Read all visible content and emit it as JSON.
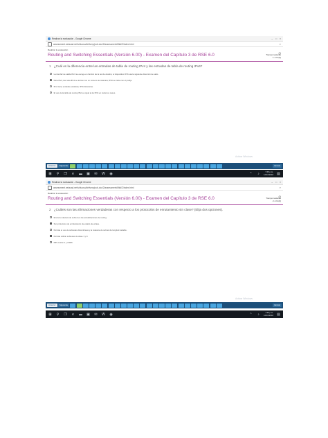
{
  "screens": [
    {
      "window_title": "Realizar la evaluación - Google Chrome",
      "url": "assessment.netacad.net/virtuoso/delivery/pub-doc/2/assessment/kfkd/Z/index.html",
      "breadcrumb": "Realizar la evaluación",
      "exam_title": "Routing and Switching Essentials (Versión 6.00) - Examen del Capítulo 3 de RSE 6.0",
      "timer_label": "Tiempo restante",
      "timer_value": "00:00",
      "progress": "1 / 24 (0)",
      "question_number": "1",
      "question_text": "¿Cuál es la diferencia entre las entradas de tabla de routing IPv4 y las entradas de tabla de routing IPv6?",
      "options": [
        "La interfaz de salida IPv4 se escoge en función de la red de destino; el dispositivo IPv6 usa la siguiente dirección de salto.",
        "Para IPv4, las rutas IPv4 se inician con un número de máscara; IPv6 se inicia con el prefijo.",
        "IPv4 tiene entradas estáticas; IPv6 dinámicas.",
        "El uso de la tabla de routing IPv4 es igual al de IPv6 en todos los casos."
      ],
      "selected_index": 1,
      "input_type": "radio",
      "watermark": "Activar Windows",
      "nav": {
        "prev": "Anterior",
        "next": "Siguiente",
        "submit": "Enviar"
      },
      "clock": {
        "time": "7:45 p.m.",
        "date": "12/10/2018"
      }
    },
    {
      "window_title": "Realizar la evaluación - Google Chrome",
      "url": "assessment.netacad.net/virtuoso/delivery/pub-doc/2/assessment/kfkd/Z/index.html",
      "breadcrumb": "Realizar la evaluación",
      "exam_title": "Routing and Switching Essentials (Versión 6.00) - Examen del Capítulo 3 de RSE 6.0",
      "timer_label": "Tiempo restante",
      "timer_value": "00:00",
      "progress": "2 / 24 (0)",
      "question_number": "2",
      "question_text": "¿Cuáles son las afirmaciones verdaderas con respecto a los protocolos de enrutamiento sin clase? (Elija dos opciones).",
      "options": [
        "Envía la máscara de subred en las actualizaciones de routing.",
        "Son protocolos de enrutamiento de estado de enlace.",
        "Permite el uso de subredes discontinuas y la máscara de subred de longitud variable.",
        "Permite utilizar subredes de clase 1 y 0.",
        "RIP versión 1 y OSPF."
      ],
      "selected_indices": [
        1,
        3
      ],
      "input_type": "checkbox",
      "watermark": "Activar Windows",
      "nav": {
        "prev": "Anterior",
        "next": "Siguiente",
        "submit": "Enviar"
      },
      "clock": {
        "time": "7:46 p.m.",
        "date": "12/10/2018"
      }
    }
  ]
}
